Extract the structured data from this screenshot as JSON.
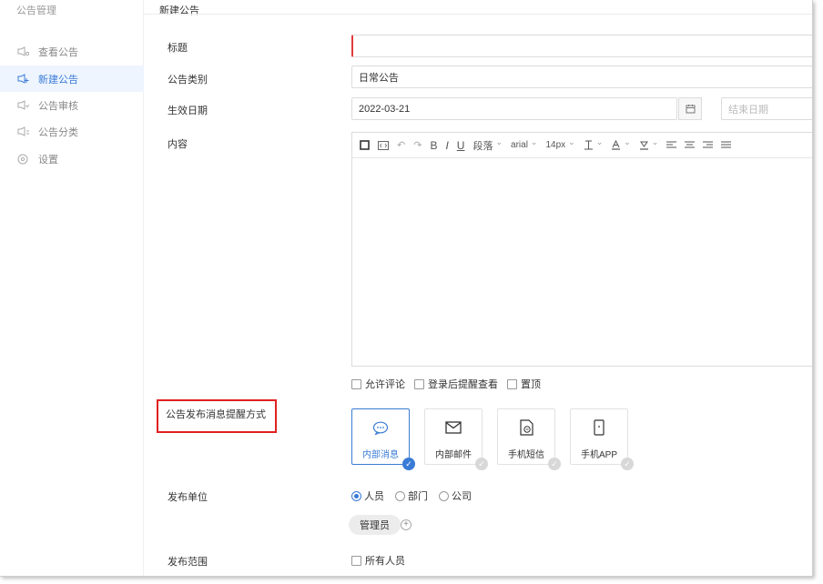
{
  "sidebar": {
    "header": "公告管理",
    "items": [
      {
        "label": "查看公告",
        "icon": "announce-icon"
      },
      {
        "label": "新建公告",
        "icon": "announce-add-icon"
      },
      {
        "label": "公告审核",
        "icon": "announce-review-icon"
      },
      {
        "label": "公告分类",
        "icon": "announce-category-icon"
      },
      {
        "label": "设置",
        "icon": "settings-icon"
      }
    ]
  },
  "page": {
    "title": "新建公告"
  },
  "form": {
    "title_label": "标题",
    "title_value": "",
    "category_label": "公告类别",
    "category_value": "日常公告",
    "date_label": "生效日期",
    "start_date": "2022-03-21",
    "end_date_placeholder": "结束日期",
    "content_label": "内容",
    "toolbar": {
      "paragraph": "段落",
      "font": "arial",
      "size": "14px",
      "bold": "B",
      "italic": "I",
      "underline": "U"
    },
    "options": [
      "允许评论",
      "登录后提醒查看",
      "置顶"
    ],
    "notify_label": "公告发布消息提醒方式",
    "notify_methods": [
      {
        "label": "内部消息",
        "icon": "chat-bubble-icon",
        "selected": true
      },
      {
        "label": "内部邮件",
        "icon": "mail-icon",
        "selected": false
      },
      {
        "label": "手机短信",
        "icon": "sms-icon",
        "selected": false
      },
      {
        "label": "手机APP",
        "icon": "phone-icon",
        "selected": false
      }
    ],
    "publisher_label": "发布单位",
    "publisher_options": [
      {
        "label": "人员",
        "selected": true
      },
      {
        "label": "部门",
        "selected": false
      },
      {
        "label": "公司",
        "selected": false
      }
    ],
    "publisher_tag": "管理员",
    "scope_label": "发布范围",
    "scope_option": "所有人员"
  },
  "colors": {
    "accent": "#3a7bd5",
    "highlight": "#e02020"
  }
}
